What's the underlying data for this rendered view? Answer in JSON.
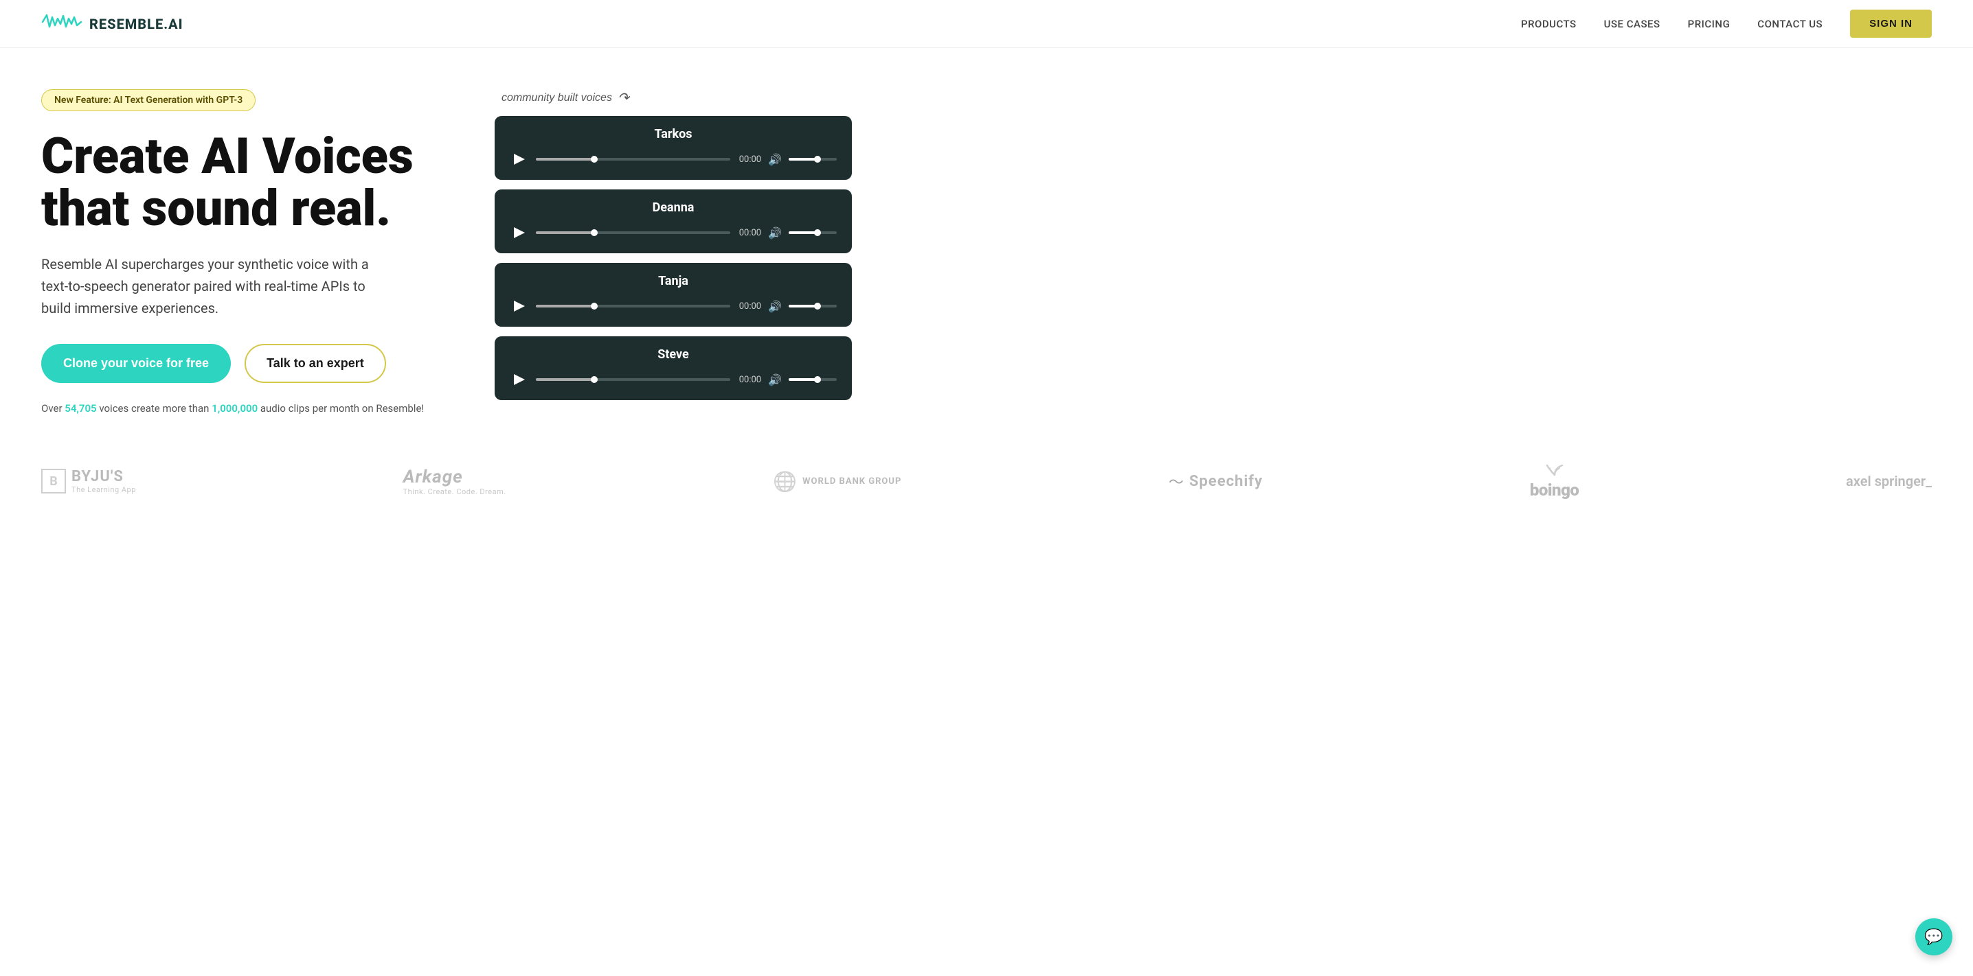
{
  "header": {
    "logo_wave": "∿∿∿",
    "logo_text": "RESEMBLE.AI",
    "nav": {
      "products": "PRODUCTS",
      "use_cases": "USE CASES",
      "pricing": "PRICING",
      "contact_us": "CONTACT US"
    },
    "sign_in": "SIGN IN"
  },
  "hero": {
    "badge": "New Feature: AI Text Generation with GPT-3",
    "title_line1": "Create AI Voices",
    "title_line2": "that sound real.",
    "description": "Resemble AI supercharges your synthetic voice with a text-to-speech generator paired with real-time APIs to build immersive experiences.",
    "btn_clone": "Clone your voice for free",
    "btn_expert": "Talk to an expert",
    "stats_pre": "Over ",
    "stats_voices": "54,705",
    "stats_mid": " voices create more than ",
    "stats_clips": "1,000,000",
    "stats_post": " audio clips per month on Resemble!",
    "community_label": "community built voices"
  },
  "audio_cards": [
    {
      "id": "tarkos",
      "name": "Tarkos",
      "time": "00:00"
    },
    {
      "id": "deanna",
      "name": "Deanna",
      "time": "00:00"
    },
    {
      "id": "tanja",
      "name": "Tanja",
      "time": "00:00"
    },
    {
      "id": "steve",
      "name": "Steve",
      "time": "00:00"
    }
  ],
  "logos": [
    {
      "id": "byjus",
      "name": "BYJU'S",
      "sub": "The Learning App"
    },
    {
      "id": "arkage",
      "name": "Arkage",
      "sub": "Think. Create. Code. Dream."
    },
    {
      "id": "worldbank",
      "name": "WORLD BANK GROUP",
      "sub": ""
    },
    {
      "id": "speechify",
      "name": "Speechify",
      "sub": ""
    },
    {
      "id": "boingo",
      "name": "boingo",
      "sub": ""
    },
    {
      "id": "axelspringer",
      "name": "axel springer_",
      "sub": ""
    }
  ]
}
